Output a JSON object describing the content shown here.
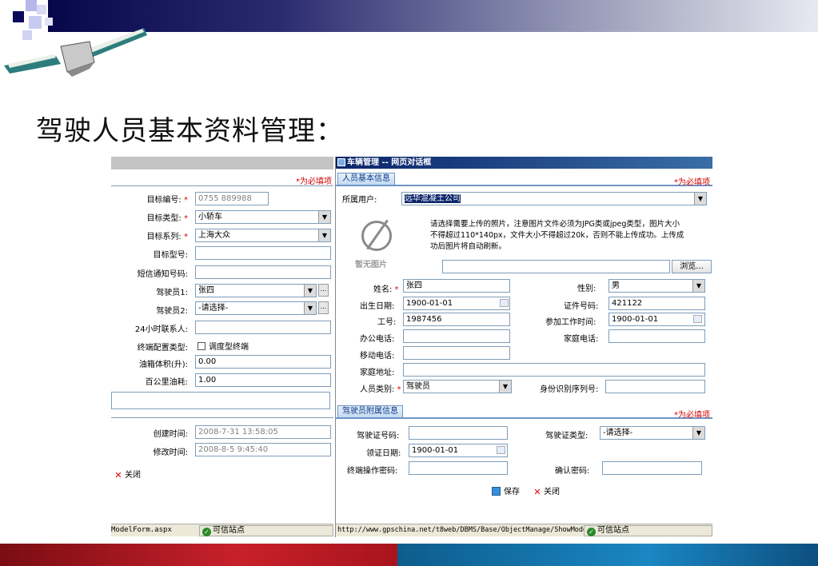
{
  "slide": {
    "title": "驾驶人员基本资料管理："
  },
  "left_window": {
    "required_note": "*为必填项",
    "fields": [
      {
        "label": "目标编号:",
        "required": true,
        "value": "0755  889988",
        "type": "input"
      },
      {
        "label": "目标类型:",
        "required": true,
        "value": "小轿车",
        "type": "select"
      },
      {
        "label": "目标系列:",
        "required": true,
        "value": "上海大众",
        "type": "select"
      },
      {
        "label": "目标型号:",
        "required": false,
        "value": "",
        "type": "input"
      },
      {
        "label": "短信通知号码:",
        "required": false,
        "value": "",
        "type": "input"
      },
      {
        "label": "驾驶员1:",
        "required": false,
        "value": "张四",
        "type": "select"
      },
      {
        "label": "驾驶员2:",
        "required": false,
        "value": "-请选择-",
        "type": "select"
      },
      {
        "label": "24小时联系人:",
        "required": false,
        "value": "",
        "type": "input"
      },
      {
        "label": "终端配置类型:",
        "required": false,
        "value": "调度型终端",
        "type": "checkbox"
      },
      {
        "label": "油箱体积(升):",
        "required": false,
        "value": "0.00",
        "type": "input"
      },
      {
        "label": "百公里油耗:",
        "required": false,
        "value": "1.00",
        "type": "input"
      }
    ],
    "created_label": "创建时间:",
    "created_value": "2008-7-31 13:58:05",
    "modified_label": "修改时间:",
    "modified_value": "2008-8-5 9:45:40",
    "close_label": "关闭",
    "status_url": "ModelForm.aspx",
    "status_trusted": "可信站点"
  },
  "right_window": {
    "title": "车辆管理 -- 网页对话框",
    "tab_basic": "人员基本信息",
    "required_note": "*为必填项",
    "owner_label": "所属用户:",
    "owner_value": "远华混凝土公司",
    "photo_placeholder": "暂无图片",
    "upload_info": "请选择需要上传的照片，注意图片文件必须为JPG类或jpeg类型，图片大小不得超过110*140px，文件大小不得超过20k，否则不能上传成功。上传成功后图片将自动刷新。",
    "browse_label": "浏览...",
    "name_label": "姓名:",
    "name_value": "张四",
    "gender_label": "性别:",
    "gender_value": "男",
    "birth_label": "出生日期:",
    "birth_value": "1900-01-01",
    "idno_label": "证件号码:",
    "idno_value": "421122",
    "workno_label": "工号:",
    "workno_value": "1987456",
    "joindate_label": "参加工作时间:",
    "joindate_value": "1900-01-01",
    "officephone_label": "办公电话:",
    "homephone_label": "家庭电话:",
    "mobile_label": "移动电话:",
    "address_label": "家庭地址:",
    "persontype_label": "人员类别:",
    "persontype_value": "驾驶员",
    "idseq_label": "身份识别序列号:",
    "tab_driver": "驾驶员附属信息",
    "required_note2": "*为必填项",
    "license_label": "驾驶证号码:",
    "licensetype_label": "驾驶证类型:",
    "licensetype_value": "-请选择-",
    "licensedate_label": "领证日期:",
    "licensedate_value": "1900-01-01",
    "termpwd_label": "终端操作密码:",
    "confirmpwd_label": "确认密码:",
    "save_label": "保存",
    "close_label": "关闭",
    "status_url": "http://www.gpschina.net/t8web/DBMS/Base/ObjectManage/ShowModel",
    "status_trusted": "可信站点"
  },
  "colors": {
    "required": "#d40000",
    "title_bar": "#0a246a",
    "tab_border": "#6c95c7"
  }
}
